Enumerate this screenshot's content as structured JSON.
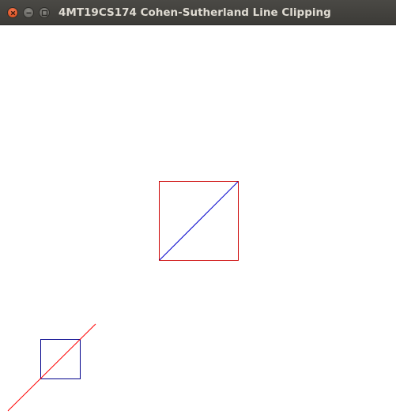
{
  "window": {
    "title": "4MT19CS174 Cohen-Sutherland Line Clipping"
  },
  "icons": {
    "close": "close-icon",
    "minimize": "minimize-icon",
    "maximize": "maximize-icon"
  },
  "colors": {
    "titlebar": "#3c3b37",
    "title_text": "#dfdbd2",
    "close_button": "#e05a2b",
    "clip_window": "#cc0000",
    "line_before": "#ff0000",
    "viewport": "#00008b",
    "clipped_line": "#0000cc",
    "background": "#ffffff"
  }
}
